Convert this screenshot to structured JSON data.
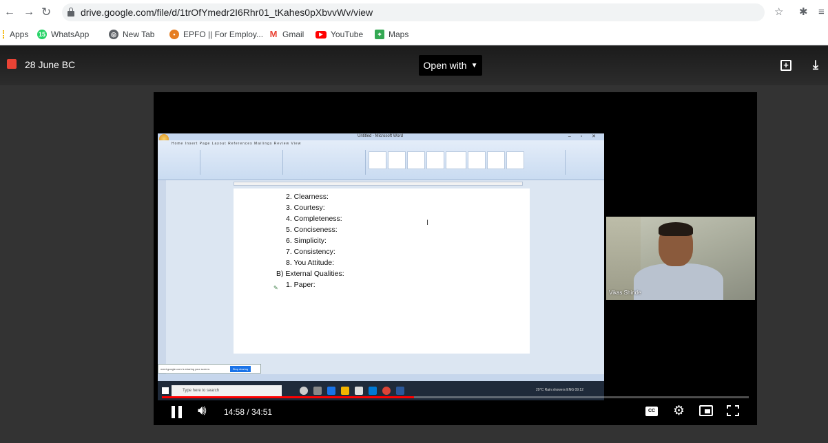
{
  "browser": {
    "url": "drive.google.com/file/d/1trOfYmedr2I6Rhr01_tKahes0pXbvvWv/view",
    "bookmarks": [
      {
        "label": "Apps",
        "icon": "apps-grid-icon"
      },
      {
        "label": "WhatsApp",
        "icon": "whatsapp-icon",
        "color": "#25d366"
      },
      {
        "label": "New Tab",
        "icon": "globe-icon",
        "color": "#5f6368"
      },
      {
        "label": "EPFO || For Employ...",
        "icon": "epfo-icon",
        "color": "#e67e22"
      },
      {
        "label": "Gmail",
        "icon": "gmail-icon",
        "color": "#ea4335"
      },
      {
        "label": "YouTube",
        "icon": "youtube-icon",
        "color": "#ff0000"
      },
      {
        "label": "Maps",
        "icon": "maps-icon",
        "color": "#34a853"
      }
    ]
  },
  "viewer": {
    "file_title": "28 June BC",
    "open_with_label": "Open with"
  },
  "video": {
    "word_window_title": "Untitled - Microsoft Word",
    "ribbon_tabs": "Home   Insert   Page Layout   References   Mailings   Review   View",
    "document_lines": [
      "2. Clearness:",
      "3. Courtesy:",
      "4. Completeness:",
      "5. Conciseness:",
      "6. Simplicity:",
      "7. Consistency:",
      "8. You Attitude:",
      "B) External Qualities:",
      "1. Paper:"
    ],
    "share_notice": "meet.google.com is sharing your screen.",
    "stop_sharing_label": "Stop sharing",
    "taskbar_search_placeholder": "Type here to search",
    "tray_text": "29°C Rain showers  ENG  09:12",
    "webcam_name": "Vikas Shinde",
    "progress_fraction": 0.43,
    "time_display": "14:58 / 34:51"
  }
}
